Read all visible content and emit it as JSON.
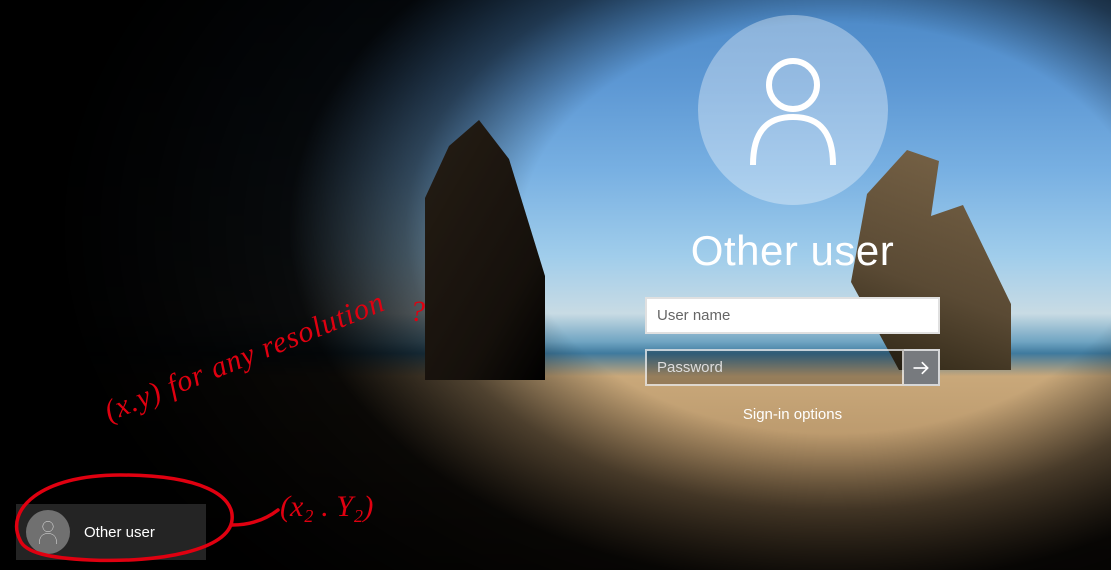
{
  "login": {
    "title": "Other user",
    "username_placeholder": "User name",
    "username_value": "",
    "password_placeholder": "Password",
    "password_value": "",
    "signin_options_label": "Sign-in options"
  },
  "user_tile": {
    "label": "Other user"
  },
  "annotations": {
    "line1": "(x.y) for any resolution",
    "qmark": "?",
    "coords2": "(x₂ . Y₂)"
  },
  "icons": {
    "avatar": "person-icon",
    "submit": "arrow-right-icon"
  },
  "colors": {
    "annotation": "#e00010",
    "tile_bg": "rgba(255,255,255,0.14)"
  }
}
